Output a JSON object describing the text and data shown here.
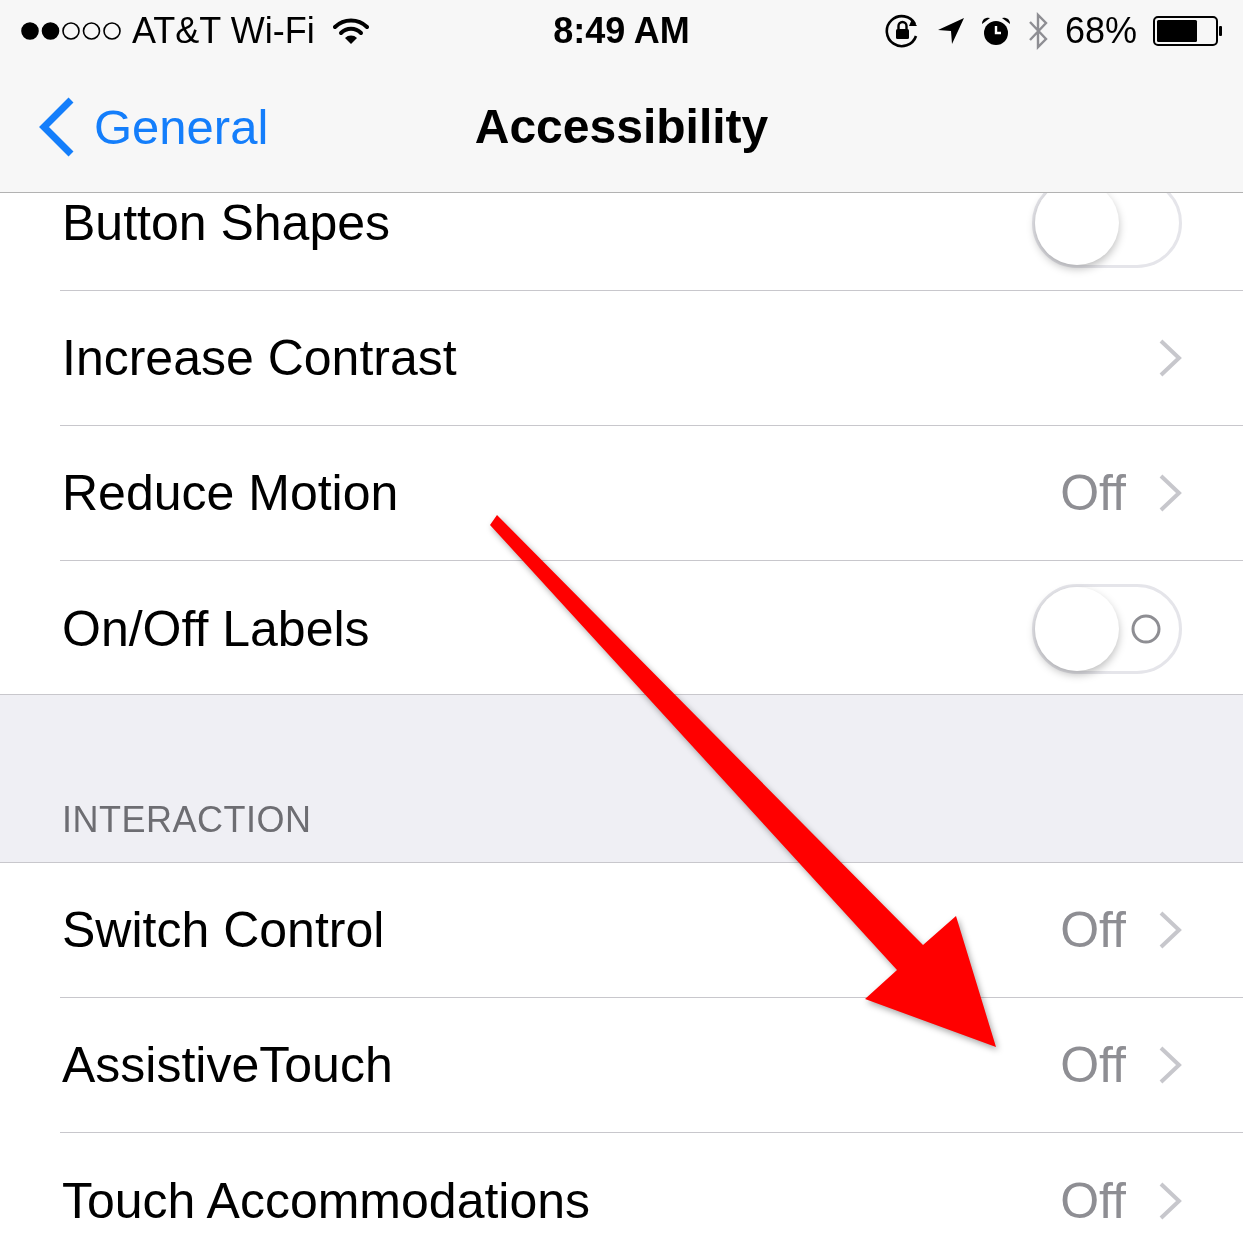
{
  "status_bar": {
    "carrier": "AT&T Wi-Fi",
    "time": "8:49 AM",
    "battery": "68%"
  },
  "nav_bar": {
    "back": "General",
    "title": "Accessibility"
  },
  "sections": [
    {
      "rows": [
        {
          "kind": "toggle",
          "label": "Button Shapes",
          "on": false,
          "off_label": false
        },
        {
          "kind": "link",
          "label": "Increase Contrast"
        },
        {
          "kind": "link",
          "label": "Reduce Motion",
          "value": "Off"
        },
        {
          "kind": "toggle",
          "label": "On/Off Labels",
          "on": false,
          "off_label": true
        }
      ]
    },
    {
      "header": "INTERACTION",
      "rows": [
        {
          "kind": "link",
          "label": "Switch Control",
          "value": "Off"
        },
        {
          "kind": "link",
          "label": "AssistiveTouch",
          "value": "Off"
        },
        {
          "kind": "link",
          "label": "Touch Accommodations",
          "value": "Off"
        }
      ]
    }
  ]
}
